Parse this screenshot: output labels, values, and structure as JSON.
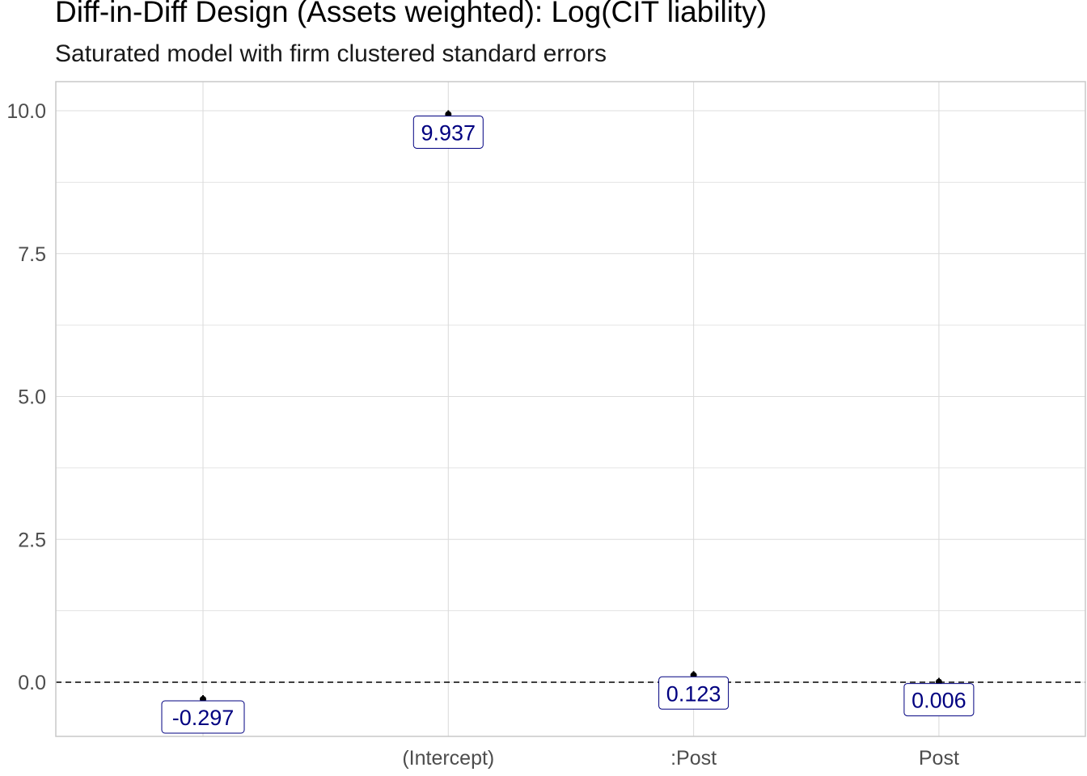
{
  "chart_data": {
    "type": "scatter",
    "title": "Diff-in-Diff Design (Assets weighted): Log(CIT liability)",
    "subtitle": "Saturated model with firm clustered standard errors",
    "xlabel": "",
    "ylabel": "",
    "categories": [
      "",
      "(Intercept)",
      ":Post",
      "Post"
    ],
    "values": [
      -0.297,
      9.937,
      0.123,
      0.006
    ],
    "labels": [
      "-0.297",
      "9.937",
      "0.123",
      "0.006"
    ],
    "ylim": [
      -0.95,
      10.5
    ],
    "yticks": [
      0.0,
      2.5,
      5.0,
      7.5,
      10.0
    ],
    "ytick_labels": [
      "0.0",
      "2.5",
      "5.0",
      "7.5",
      "10.0"
    ],
    "reference_line": 0,
    "grid": true,
    "colors": {
      "label_text": "#000080",
      "point": "#000000",
      "grid": "#dcdcdc",
      "panel_border": "#c8c8c8"
    }
  }
}
